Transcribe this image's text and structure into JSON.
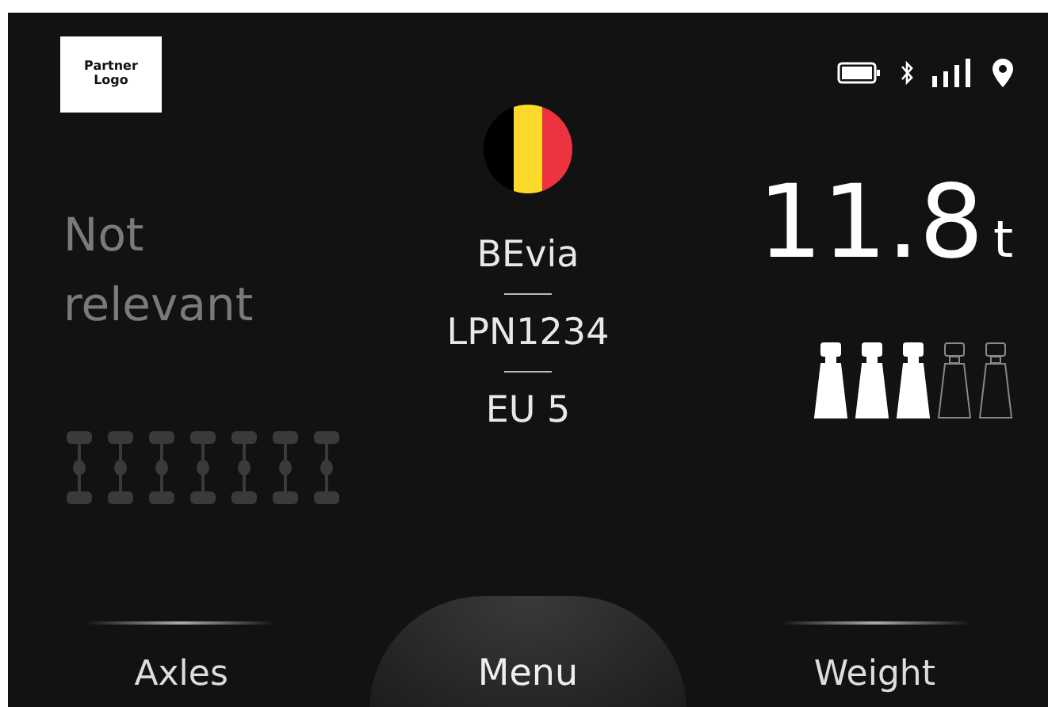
{
  "logo": {
    "text": "Partner Logo"
  },
  "axles": {
    "text": "Not relevant",
    "items": [
      {
        "active": false
      },
      {
        "active": false
      },
      {
        "active": false
      },
      {
        "active": false
      },
      {
        "active": false
      },
      {
        "active": false
      },
      {
        "active": false
      }
    ]
  },
  "vehicle": {
    "operator": "BEvia",
    "plate": "LPN1234",
    "emission_class": "EU 5"
  },
  "weight": {
    "value": "11.8",
    "unit": "t",
    "bars": [
      {
        "filled": true
      },
      {
        "filled": true
      },
      {
        "filled": true
      },
      {
        "filled": false
      },
      {
        "filled": false
      }
    ]
  },
  "nav": [
    {
      "label": "Axles",
      "kind": "tab"
    },
    {
      "label": "Menu",
      "kind": "menu"
    },
    {
      "label": "Weight",
      "kind": "tab"
    }
  ]
}
